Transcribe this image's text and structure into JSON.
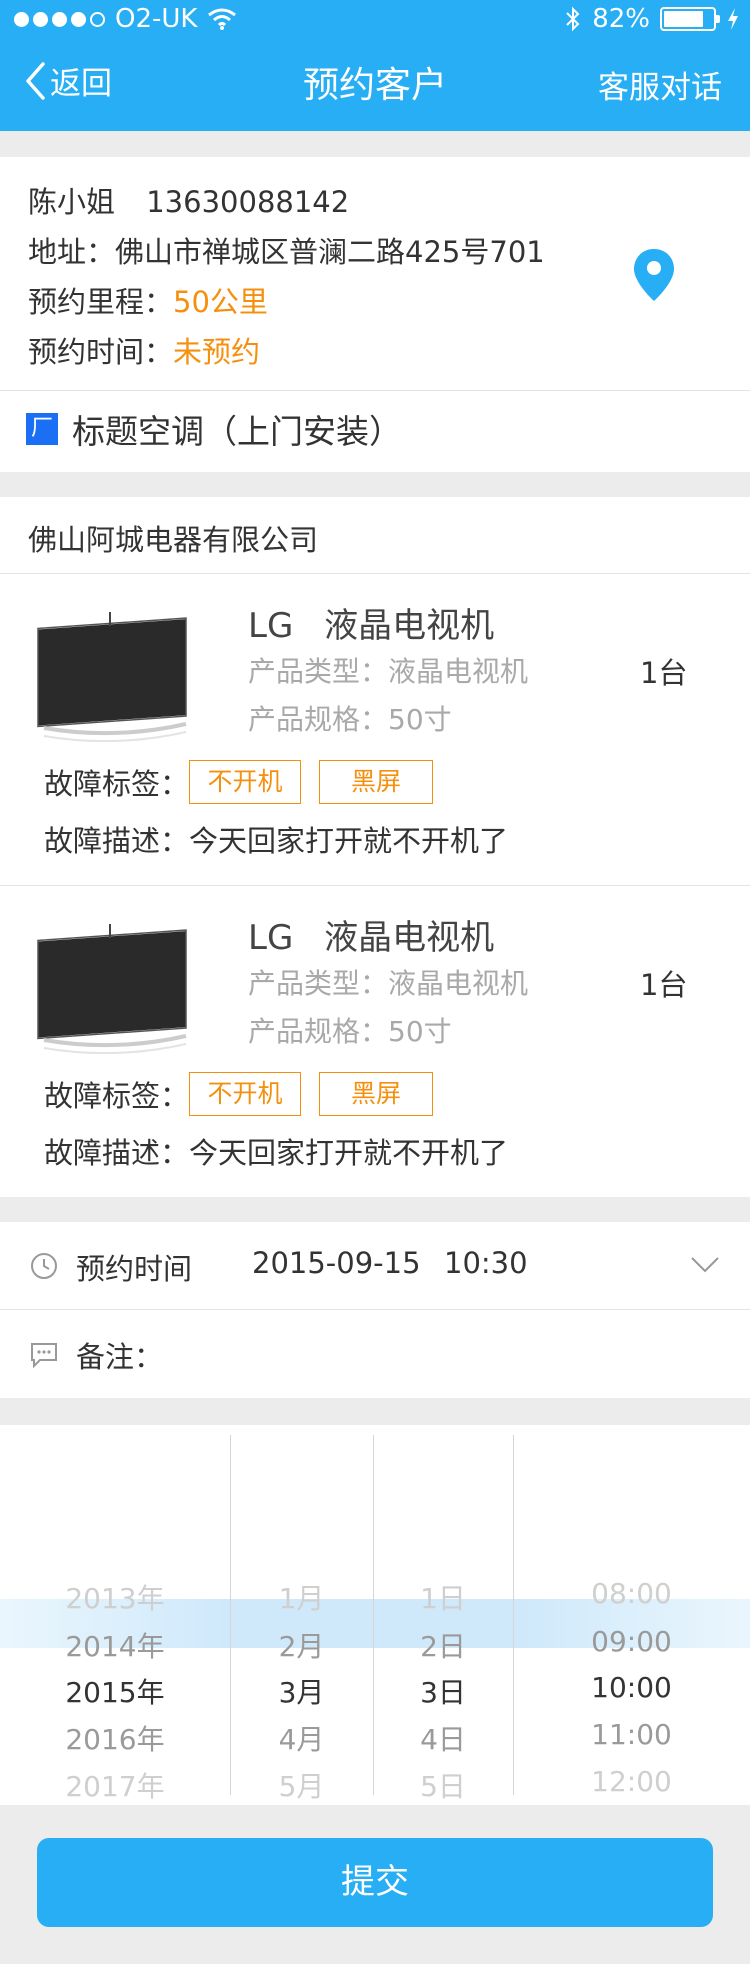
{
  "status_bar": {
    "carrier": "O2-UK",
    "battery": "82%",
    "battery_level": 0.82
  },
  "nav": {
    "back_label": "返回",
    "title": "预约客户",
    "right_label": "客服对话"
  },
  "customer": {
    "name": "陈小姐",
    "phone": "13630088142",
    "address_label": "地址：",
    "address": "佛山市禅城区普澜二路425号701",
    "distance_label": "预约里程：",
    "distance": "50公里",
    "time_label": "预约时间：",
    "time_value": "未预约",
    "location_icon": "location-pin-icon"
  },
  "service": {
    "badge": "厂",
    "title": "标题空调（上门安装）"
  },
  "company": {
    "name": "佛山阿城电器有限公司"
  },
  "products": [
    {
      "brand": "LG",
      "name": "液晶电视机",
      "type_label": "产品类型：",
      "type": "液晶电视机",
      "spec_label": "产品规格：",
      "spec": "50寸",
      "quantity": "1台",
      "fault_tags_label": "故障标签：",
      "fault_tags": [
        "不开机",
        "黑屏"
      ],
      "fault_desc_label": "故障描述：",
      "fault_desc": "今天回家打开就不开机了"
    },
    {
      "brand": "LG",
      "name": "液晶电视机",
      "type_label": "产品类型：",
      "type": "液晶电视机",
      "spec_label": "产品规格：",
      "spec": "50寸",
      "quantity": "1台",
      "fault_tags_label": "故障标签：",
      "fault_tags": [
        "不开机",
        "黑屏"
      ],
      "fault_desc_label": "故障描述：",
      "fault_desc": "今天回家打开就不开机了"
    }
  ],
  "appointment": {
    "label": "预约时间",
    "date": "2015-09-15",
    "time": "10:30"
  },
  "remarks": {
    "label": "备注："
  },
  "picker": {
    "years": [
      "2013年",
      "2014年",
      "2015年",
      "2016年",
      "2017年"
    ],
    "months": [
      "1月",
      "2月",
      "3月",
      "4月",
      "5月"
    ],
    "days": [
      "1日",
      "2日",
      "3日",
      "4日",
      "5日"
    ],
    "times": [
      "08:00",
      "09:00",
      "10:00",
      "11:00",
      "12:00"
    ],
    "selected_index": 2
  },
  "submit_label": "提交",
  "colors": {
    "primary": "#27aef5",
    "accent": "#f5900f"
  }
}
